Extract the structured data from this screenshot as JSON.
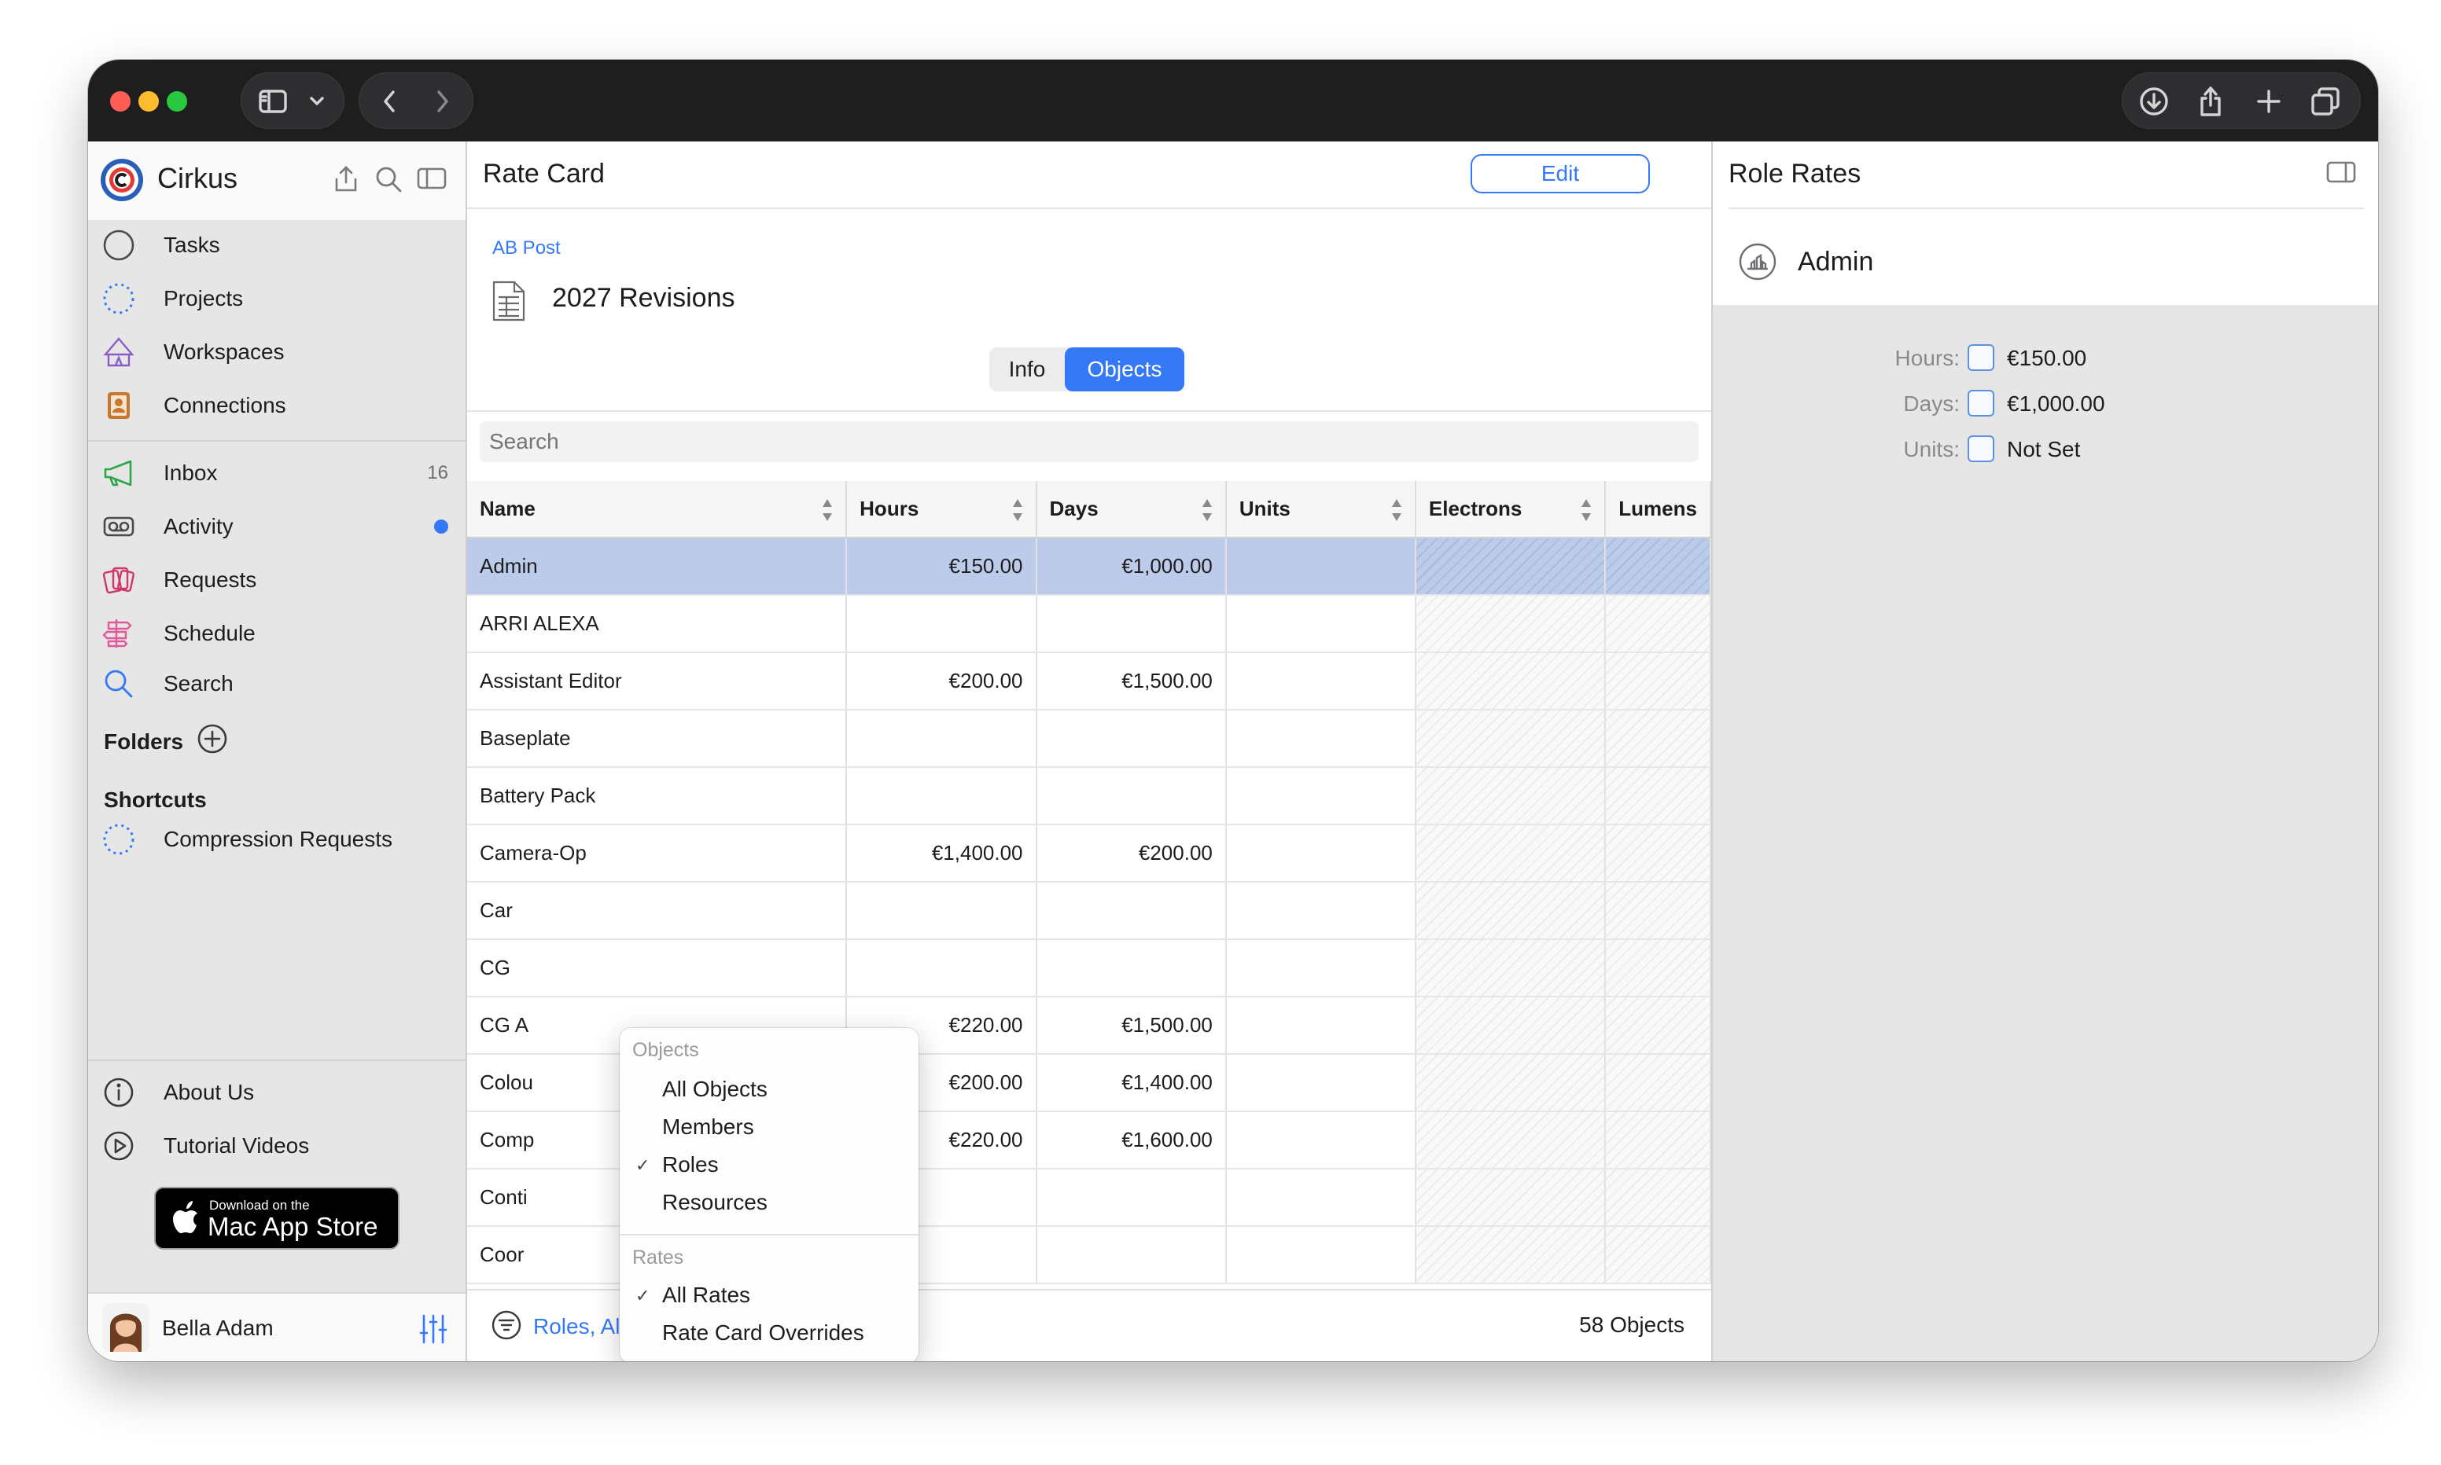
{
  "app": {
    "name": "Cirkus"
  },
  "sidebar": {
    "primary": [
      {
        "label": "Tasks",
        "icon": "circle-icon"
      },
      {
        "label": "Projects",
        "icon": "dotted-circle-icon"
      },
      {
        "label": "Workspaces",
        "icon": "tent-icon"
      },
      {
        "label": "Connections",
        "icon": "contacts-icon"
      }
    ],
    "secondary": [
      {
        "label": "Inbox",
        "icon": "megaphone-icon",
        "badge": "16"
      },
      {
        "label": "Activity",
        "icon": "voicemail-icon"
      },
      {
        "label": "Requests",
        "icon": "cards-icon"
      },
      {
        "label": "Schedule",
        "icon": "signpost-icon"
      },
      {
        "label": "Search",
        "icon": "search-icon"
      }
    ],
    "folders_label": "Folders",
    "shortcuts_label": "Shortcuts",
    "shortcuts": [
      {
        "label": "Compression Requests",
        "icon": "dotted-circle-icon"
      }
    ],
    "bottom": [
      {
        "label": "About Us",
        "icon": "info-icon"
      },
      {
        "label": "Tutorial Videos",
        "icon": "play-icon"
      }
    ],
    "app_store": {
      "small": "Download on the",
      "large": "Mac App Store"
    },
    "user": {
      "name": "Bella Adam"
    }
  },
  "center": {
    "title": "Rate Card",
    "edit_label": "Edit",
    "breadcrumb": "AB Post",
    "doc_title": "2027 Revisions",
    "tabs": [
      "Info",
      "Objects"
    ],
    "active_tab": "Objects",
    "search_placeholder": "Search",
    "columns": [
      "Name",
      "Hours",
      "Days",
      "Units",
      "Electrons",
      "Lumens"
    ],
    "rows": [
      {
        "name": "Admin",
        "hours": "€150.00",
        "days": "€1,000.00",
        "units": "",
        "selected": true
      },
      {
        "name": "ARRI ALEXA",
        "hours": "",
        "days": "",
        "units": ""
      },
      {
        "name": "Assistant Editor",
        "hours": "€200.00",
        "days": "€1,500.00",
        "units": ""
      },
      {
        "name": "Baseplate",
        "hours": "",
        "days": "",
        "units": ""
      },
      {
        "name": "Battery Pack",
        "hours": "",
        "days": "",
        "units": ""
      },
      {
        "name": "Camera-Op",
        "hours": "€1,400.00",
        "days": "€200.00",
        "units": ""
      },
      {
        "name": "Car",
        "hours": "",
        "days": "",
        "units": ""
      },
      {
        "name": "CG",
        "hours": "",
        "days": "",
        "units": ""
      },
      {
        "name": "CG A",
        "hours": "€220.00",
        "days": "€1,500.00",
        "units": ""
      },
      {
        "name": "Colou",
        "hours": "€200.00",
        "days": "€1,400.00",
        "units": ""
      },
      {
        "name": "Comp",
        "hours": "€220.00",
        "days": "€1,600.00",
        "units": ""
      },
      {
        "name": "Conti",
        "hours": "",
        "days": "",
        "units": ""
      },
      {
        "name": "Coor",
        "hours": "",
        "days": "",
        "units": ""
      }
    ],
    "footer": {
      "filter_label": "Roles, All Rates",
      "count": "58 Objects"
    }
  },
  "menu": {
    "sections": [
      {
        "header": "Objects",
        "items": [
          {
            "label": "All Objects",
            "checked": false
          },
          {
            "label": "Members",
            "checked": false
          },
          {
            "label": "Roles",
            "checked": true
          },
          {
            "label": "Resources",
            "checked": false
          }
        ]
      },
      {
        "header": "Rates",
        "items": [
          {
            "label": "All Rates",
            "checked": true
          },
          {
            "label": "Rate Card Overrides",
            "checked": false
          }
        ]
      }
    ],
    "check_glyph": "✓"
  },
  "right": {
    "title": "Role Rates",
    "role_name": "Admin",
    "rates": [
      {
        "label": "Hours:",
        "value": "€150.00"
      },
      {
        "label": "Days:",
        "value": "€1,000.00"
      },
      {
        "label": "Units:",
        "value": "Not Set"
      }
    ]
  },
  "colors": {
    "accent": "#3478f6",
    "selection": "#bccbea",
    "sidebar": "#e6e6e6",
    "titlebar": "#1e1e1e"
  }
}
